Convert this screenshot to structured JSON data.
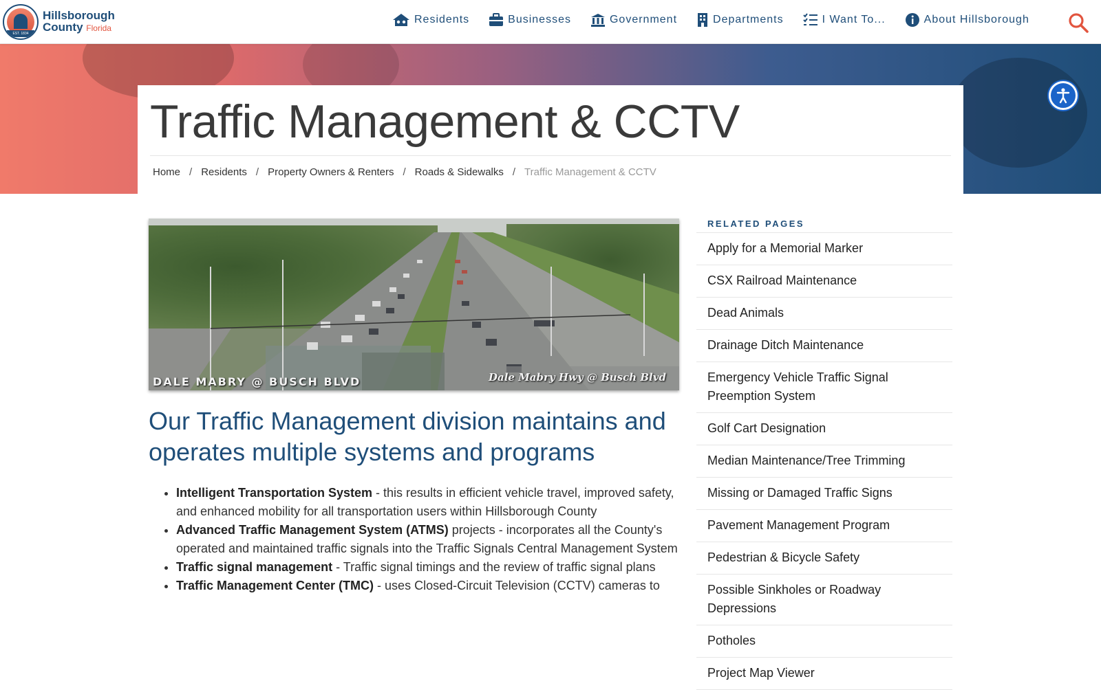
{
  "header": {
    "logo": {
      "line1": "Hillsborough",
      "line2": "County",
      "state": "Florida",
      "seal_text": "EST. 1834"
    },
    "nav": [
      {
        "label": "Residents",
        "icon": "residents-house-icon"
      },
      {
        "label": "Businesses",
        "icon": "briefcase-icon"
      },
      {
        "label": "Government",
        "icon": "government-building-icon"
      },
      {
        "label": "Departments",
        "icon": "office-building-icon"
      },
      {
        "label": "I Want To...",
        "icon": "checklist-icon"
      },
      {
        "label": "About Hillsborough",
        "icon": "info-circle-icon"
      }
    ],
    "search_icon": "search-icon",
    "accent_color": "#1f4e79",
    "search_color": "#e2553f"
  },
  "page": {
    "title": "Traffic Management & CCTV",
    "breadcrumb": [
      "Home",
      "Residents",
      "Property Owners & Renters",
      "Roads & Sidewalks",
      "Traffic Management & CCTV"
    ]
  },
  "camera": {
    "caption_left": "DALE MABRY @ BUSCH BLVD",
    "caption_right": "Dale Mabry Hwy @ Busch Blvd"
  },
  "main": {
    "lead": "Our Traffic Management division maintains and operates multiple systems and programs",
    "items": [
      {
        "term": "Intelligent Transportation System",
        "text": " - this results in efficient vehicle travel, improved safety, and enhanced mobility for all transportation users within Hillsborough County"
      },
      {
        "term": "Advanced Traffic Management System (ATMS)",
        "text": " projects - incorporates all the County's operated and maintained traffic signals into the Traffic Signals Central Management System"
      },
      {
        "term": "Traffic signal management",
        "text": " - Traffic signal timings and the review of traffic signal plans"
      },
      {
        "term": "Traffic Management Center (TMC)",
        "text": " - uses Closed-Circuit Television (CCTV) cameras to"
      }
    ]
  },
  "sidebar": {
    "heading": "RELATED PAGES",
    "items": [
      "Apply for a Memorial Marker",
      "CSX Railroad Maintenance",
      "Dead Animals",
      "Drainage Ditch Maintenance",
      "Emergency Vehicle Traffic Signal Preemption System",
      "Golf Cart Designation",
      "Median Maintenance/Tree Trimming",
      "Missing or Damaged Traffic Signs",
      "Pavement Management Program",
      "Pedestrian & Bicycle Safety",
      "Possible Sinkholes or Roadway Depressions",
      "Potholes",
      "Project Map Viewer"
    ]
  },
  "accessibility": {
    "icon": "accessibility-icon"
  }
}
